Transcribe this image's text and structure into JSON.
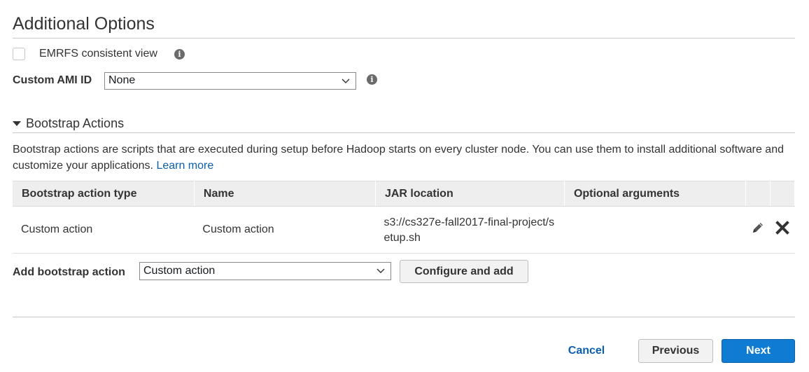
{
  "section_title": "Additional Options",
  "emrfs": {
    "label": "EMRFS consistent view",
    "checked": false
  },
  "custom_ami": {
    "label": "Custom AMI ID",
    "selected": "None"
  },
  "bootstrap": {
    "heading": "Bootstrap Actions",
    "description": "Bootstrap actions are scripts that are executed during setup before Hadoop starts on every cluster node. You can use them to install additional software and customize your applications.",
    "learn_more": "Learn more",
    "columns": [
      "Bootstrap action type",
      "Name",
      "JAR location",
      "Optional arguments"
    ],
    "rows": [
      {
        "type": "Custom action",
        "name": "Custom action",
        "jar": "s3://cs327e-fall2017-final-project/setup.sh",
        "args": ""
      }
    ],
    "add_label": "Add bootstrap action",
    "add_selected": "Custom action",
    "configure_button": "Configure and add"
  },
  "footer": {
    "cancel": "Cancel",
    "previous": "Previous",
    "next": "Next"
  },
  "icons": {
    "info": "info-icon",
    "edit": "pencil-icon",
    "delete": "close-icon",
    "dropdown": "chevron-down-icon",
    "collapse": "triangle-down-icon"
  },
  "colors": {
    "primary": "#0f7bd3",
    "link": "#0b5fb0"
  }
}
